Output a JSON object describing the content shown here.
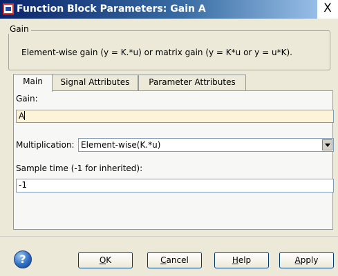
{
  "window": {
    "title": "Function Block Parameters: Gain A",
    "close_glyph": "X"
  },
  "groupbox": {
    "legend": "Gain",
    "description": "Element-wise gain (y = K.*u) or matrix gain (y = K*u or y = u*K)."
  },
  "tabs": [
    {
      "label": "Main",
      "active": true
    },
    {
      "label": "Signal Attributes",
      "active": false
    },
    {
      "label": "Parameter Attributes",
      "active": false
    }
  ],
  "main": {
    "gain_label": "Gain:",
    "gain_value": "A",
    "multiplication_label": "Multiplication:",
    "multiplication_value": "Element-wise(K.*u)",
    "sample_time_label": "Sample time (-1 for inherited):",
    "sample_time_value": "-1"
  },
  "buttons": {
    "help_icon_glyph": "?",
    "ok_mnemonic": "O",
    "ok_rest": "K",
    "cancel_mnemonic": "C",
    "cancel_rest": "ancel",
    "help_mnemonic": "H",
    "help_rest": "elp",
    "apply_mnemonic": "A",
    "apply_rest": "pply"
  }
}
